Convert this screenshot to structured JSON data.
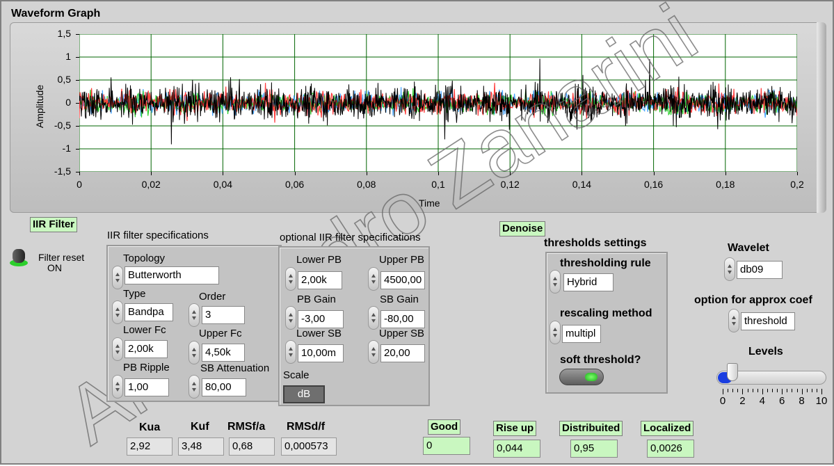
{
  "graph": {
    "title": "Waveform Graph",
    "xlabel": "Time",
    "ylabel": "Amplitude",
    "xticks": [
      "0",
      "0,02",
      "0,04",
      "0,06",
      "0,08",
      "0,1",
      "0,12",
      "0,14",
      "0,16",
      "0,18",
      "0,2"
    ],
    "yticks": [
      "1,5",
      "1",
      "0,5",
      "0",
      "-0,5",
      "-1",
      "-1,5"
    ],
    "colors": {
      "plot_bg": "#ffffff",
      "grid": "#006400",
      "s1": "#000000",
      "s2": "#ff3b3b",
      "s3": "#31d031",
      "s4": "#4aa6ff"
    }
  },
  "iir": {
    "badge": "IIR Filter",
    "reset_label": "Filter reset",
    "reset_state": "ON",
    "spec_title": "IIR filter specifications",
    "topology_label": "Topology",
    "topology_value": "Butterworth",
    "type_label": "Type",
    "type_value": "Bandpa",
    "order_label": "Order",
    "order_value": "3",
    "lower_fc_label": "Lower Fc",
    "lower_fc_value": "2,00k",
    "upper_fc_label": "Upper Fc",
    "upper_fc_value": "4,50k",
    "pb_ripple_label": "PB Ripple",
    "pb_ripple_value": "1,00",
    "sb_att_label": "SB Attenuation",
    "sb_att_value": "80,00"
  },
  "opt": {
    "title": "optional IIR filter specifications",
    "lower_pb_label": "Lower PB",
    "lower_pb_value": "2,00k",
    "upper_pb_label": "Upper PB",
    "upper_pb_value": "4500,00",
    "pb_gain_label": "PB Gain",
    "pb_gain_value": "-3,00",
    "sb_gain_label": "SB Gain",
    "sb_gain_value": "-80,00",
    "lower_sb_label": "Lower SB",
    "lower_sb_value": "10,00m",
    "upper_sb_label": "Upper SB",
    "upper_sb_value": "20,00",
    "scale_label": "Scale",
    "scale_value": "dB"
  },
  "denoise": {
    "badge": "Denoise",
    "thresholds_title": "thresholds settings",
    "rule_label": "thresholding rule",
    "rule_value": "Hybrid",
    "rescale_label": "rescaling method",
    "rescale_value": "multipl",
    "soft_label": "soft threshold?",
    "wavelet_label": "Wavelet",
    "wavelet_value": "db09",
    "approx_label": "option for approx coef",
    "approx_value": "threshold",
    "levels_label": "Levels",
    "levels_ticks": [
      "0",
      "2",
      "4",
      "6",
      "8",
      "10"
    ],
    "levels_value": 1,
    "levels_max": 10
  },
  "results": {
    "kua_label": "Kua",
    "kua_value": "2,92",
    "kuf_label": "Kuf",
    "kuf_value": "3,48",
    "rmsfa_label": "RMSf/a",
    "rmsfa_value": "0,68",
    "rmsdf_label": "RMSd/f",
    "rmsdf_value": "0,000573",
    "good_label": "Good",
    "good_value": "0",
    "rise_label": "Rise up",
    "rise_value": "0,044",
    "distr_label": "Distribuited",
    "distr_value": "0,95",
    "local_label": "Localized",
    "local_value": "0,0026"
  },
  "watermark": "Alessandro Zanarini"
}
